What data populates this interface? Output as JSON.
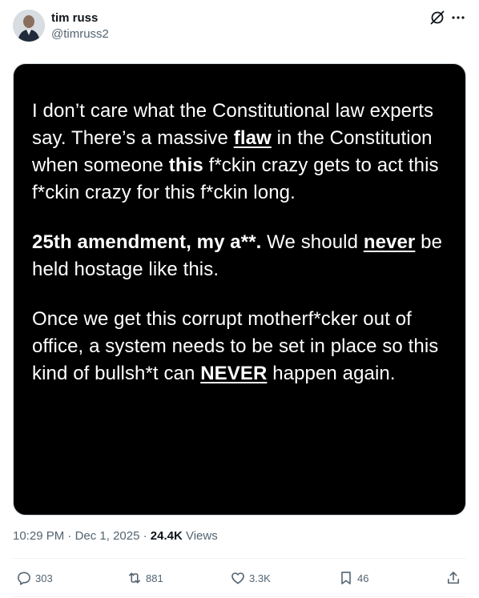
{
  "author": {
    "display_name": "tim russ",
    "handle": "@timruss2"
  },
  "header_icons": [
    "grok-icon",
    "more-icon"
  ],
  "media_text": {
    "p1_a": "I don’t care what the Constitutional law experts say. There’s a massive ",
    "p1_flaw": "flaw",
    "p1_b": " in the Constitution when someone ",
    "p1_this": "this",
    "p1_c": " f*ckin crazy gets to act this f*ckin crazy for this f*ckin long.",
    "p2_bold": "25th amendment, my a**.",
    "p2_a": " We should ",
    "p2_never": "never",
    "p2_b": " be held hostage like this.",
    "p3_a": "Once we get this corrupt motherf*cker out of office, a system needs to be set in place so this kind of bullsh*t can ",
    "p3_never": "NEVER",
    "p3_b": " happen again."
  },
  "meta": {
    "time": "10:29 PM",
    "separator": " · ",
    "date": "Dec 1, 2025",
    "views_count": "24.4K",
    "views_label": " Views"
  },
  "actions": {
    "replies": "303",
    "reposts": "881",
    "likes": "3.3K",
    "bookmarks": "46"
  },
  "colors": {
    "text_primary": "#0f1419",
    "text_secondary": "#536471",
    "media_bg": "#000000",
    "divider": "#eff3f4"
  }
}
